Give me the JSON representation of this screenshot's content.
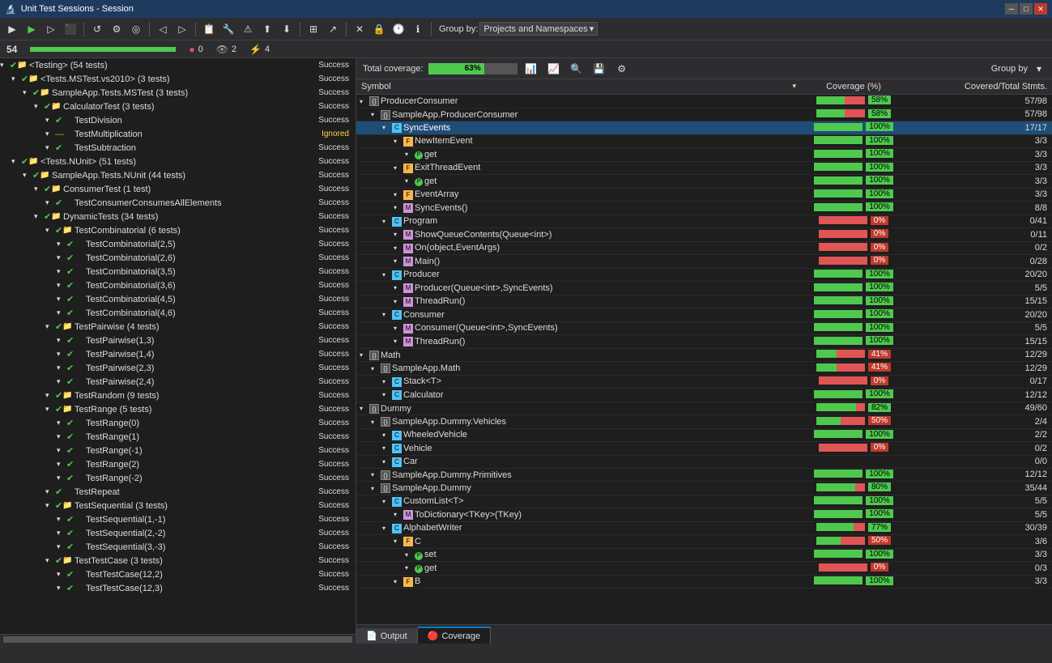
{
  "titleBar": {
    "title": "Unit Test Sessions - Session",
    "winButtons": [
      "minimize",
      "maximize",
      "close"
    ]
  },
  "toolbar": {
    "groupByLabel": "Group by:",
    "groupByValue": "Projects and Namespaces"
  },
  "statsBar": {
    "totalRun": "54",
    "failedCount": "0",
    "passedCount": "2",
    "ignoredCount": "4",
    "progressWidth": "100"
  },
  "leftPanel": {
    "rows": [
      {
        "indent": 0,
        "expand": true,
        "iconType": "check-folder",
        "label": "<Testing> (54 tests)",
        "status": "Success",
        "bold": false
      },
      {
        "indent": 1,
        "expand": true,
        "iconType": "check-folder",
        "label": "<Tests.MSTest.vs2010> (3 tests)",
        "status": "Success",
        "bold": false
      },
      {
        "indent": 2,
        "expand": true,
        "iconType": "check-folder",
        "label": "SampleApp.Tests.MSTest (3 tests)",
        "status": "Success",
        "bold": false
      },
      {
        "indent": 3,
        "expand": true,
        "iconType": "check-folder",
        "label": "CalculatorTest (3 tests)",
        "status": "Success",
        "bold": false
      },
      {
        "indent": 4,
        "expand": false,
        "iconType": "check",
        "label": "TestDivision",
        "status": "Success",
        "bold": false
      },
      {
        "indent": 4,
        "expand": false,
        "iconType": "check",
        "label": "TestMultiplication",
        "status": "Ignored",
        "bold": false
      },
      {
        "indent": 4,
        "expand": false,
        "iconType": "check",
        "label": "TestSubtraction",
        "status": "Success",
        "bold": false
      },
      {
        "indent": 1,
        "expand": true,
        "iconType": "check-folder",
        "label": "<Tests.NUnit> (51 tests)",
        "status": "Success",
        "bold": false
      },
      {
        "indent": 2,
        "expand": true,
        "iconType": "check-folder",
        "label": "SampleApp.Tests.NUnit (44 tests)",
        "status": "Success",
        "bold": false
      },
      {
        "indent": 3,
        "expand": true,
        "iconType": "check-folder",
        "label": "ConsumerTest (1 test)",
        "status": "Success",
        "bold": false
      },
      {
        "indent": 4,
        "expand": false,
        "iconType": "check",
        "label": "TestConsumerConsumesAllElements",
        "status": "Success",
        "bold": false
      },
      {
        "indent": 3,
        "expand": true,
        "iconType": "check-folder",
        "label": "DynamicTests (34 tests)",
        "status": "Success",
        "bold": false
      },
      {
        "indent": 4,
        "expand": true,
        "iconType": "check-folder",
        "label": "TestCombinatorial (6 tests)",
        "status": "Success",
        "bold": false
      },
      {
        "indent": 5,
        "expand": false,
        "iconType": "check",
        "label": "TestCombinatorial(2,5)",
        "status": "Success",
        "bold": false
      },
      {
        "indent": 5,
        "expand": false,
        "iconType": "check",
        "label": "TestCombinatorial(2,6)",
        "status": "Success",
        "bold": false
      },
      {
        "indent": 5,
        "expand": false,
        "iconType": "check",
        "label": "TestCombinatorial(3,5)",
        "status": "Success",
        "bold": false
      },
      {
        "indent": 5,
        "expand": false,
        "iconType": "check",
        "label": "TestCombinatorial(3,6)",
        "status": "Success",
        "bold": false
      },
      {
        "indent": 5,
        "expand": false,
        "iconType": "check",
        "label": "TestCombinatorial(4,5)",
        "status": "Success",
        "bold": false
      },
      {
        "indent": 5,
        "expand": false,
        "iconType": "check",
        "label": "TestCombinatorial(4,6)",
        "status": "Success",
        "bold": false
      },
      {
        "indent": 4,
        "expand": true,
        "iconType": "check-folder",
        "label": "TestPairwise (4 tests)",
        "status": "Success",
        "bold": false
      },
      {
        "indent": 5,
        "expand": false,
        "iconType": "check",
        "label": "TestPairwise(1,3)",
        "status": "Success",
        "bold": false
      },
      {
        "indent": 5,
        "expand": false,
        "iconType": "check",
        "label": "TestPairwise(1,4)",
        "status": "Success",
        "bold": false
      },
      {
        "indent": 5,
        "expand": false,
        "iconType": "check",
        "label": "TestPairwise(2,3)",
        "status": "Success",
        "bold": false
      },
      {
        "indent": 5,
        "expand": false,
        "iconType": "check",
        "label": "TestPairwise(2,4)",
        "status": "Success",
        "bold": false
      },
      {
        "indent": 4,
        "expand": true,
        "iconType": "check-folder",
        "label": "TestRandom (9 tests)",
        "status": "Success",
        "bold": false
      },
      {
        "indent": 4,
        "expand": true,
        "iconType": "check-folder",
        "label": "TestRange (5 tests)",
        "status": "Success",
        "bold": false
      },
      {
        "indent": 5,
        "expand": false,
        "iconType": "check",
        "label": "TestRange(0)",
        "status": "Success",
        "bold": false
      },
      {
        "indent": 5,
        "expand": false,
        "iconType": "check",
        "label": "TestRange(1)",
        "status": "Success",
        "bold": false
      },
      {
        "indent": 5,
        "expand": false,
        "iconType": "check",
        "label": "TestRange(-1)",
        "status": "Success",
        "bold": false
      },
      {
        "indent": 5,
        "expand": false,
        "iconType": "check",
        "label": "TestRange(2)",
        "status": "Success",
        "bold": false
      },
      {
        "indent": 5,
        "expand": false,
        "iconType": "check",
        "label": "TestRange(-2)",
        "status": "Success",
        "bold": false
      },
      {
        "indent": 4,
        "expand": false,
        "iconType": "check",
        "label": "TestRepeat",
        "status": "Success",
        "bold": false
      },
      {
        "indent": 4,
        "expand": true,
        "iconType": "check-folder",
        "label": "TestSequential (3 tests)",
        "status": "Success",
        "bold": false
      },
      {
        "indent": 5,
        "expand": false,
        "iconType": "check",
        "label": "TestSequential(1,-1)",
        "status": "Success",
        "bold": false
      },
      {
        "indent": 5,
        "expand": false,
        "iconType": "check",
        "label": "TestSequential(2,-2)",
        "status": "Success",
        "bold": false
      },
      {
        "indent": 5,
        "expand": false,
        "iconType": "check",
        "label": "TestSequential(3,-3)",
        "status": "Success",
        "bold": false
      },
      {
        "indent": 4,
        "expand": true,
        "iconType": "check-folder",
        "label": "TestTestCase (3 tests)",
        "status": "Success",
        "bold": false
      },
      {
        "indent": 5,
        "expand": false,
        "iconType": "check",
        "label": "TestTestCase(12,2)",
        "status": "Success",
        "bold": false
      },
      {
        "indent": 5,
        "expand": false,
        "iconType": "check",
        "label": "TestTestCase(12,3)",
        "status": "Success",
        "bold": false
      }
    ]
  },
  "coveragePanel": {
    "totalCoverage": "63%",
    "groupByLabel": "Group by",
    "columns": {
      "symbol": "Symbol",
      "coveragePct": "Coverage (%)",
      "coveredTotal": "Covered/Total Stmts."
    },
    "rows": [
      {
        "indent": 0,
        "expand": true,
        "iconType": "namespace",
        "label": "ProducerConsumer",
        "pct": "58%",
        "pctType": "green",
        "covered": "57/98",
        "barGreen": 58
      },
      {
        "indent": 1,
        "expand": true,
        "iconType": "namespace",
        "label": "SampleApp.ProducerConsumer",
        "pct": "58%",
        "pctType": "green",
        "covered": "57/98",
        "barGreen": 58
      },
      {
        "indent": 2,
        "expand": true,
        "iconType": "class",
        "label": "SyncEvents",
        "pct": "100%",
        "pctType": "green",
        "covered": "17/17",
        "barGreen": 100,
        "selected": true
      },
      {
        "indent": 3,
        "expand": true,
        "iconType": "field",
        "label": "NewItemEvent",
        "pct": "100%",
        "pctType": "green",
        "covered": "3/3",
        "barGreen": 100
      },
      {
        "indent": 4,
        "expand": false,
        "iconType": "property",
        "label": "get",
        "pct": "100%",
        "pctType": "green",
        "covered": "3/3",
        "barGreen": 100
      },
      {
        "indent": 3,
        "expand": true,
        "iconType": "field",
        "label": "ExitThreadEvent",
        "pct": "100%",
        "pctType": "green",
        "covered": "3/3",
        "barGreen": 100
      },
      {
        "indent": 4,
        "expand": false,
        "iconType": "property",
        "label": "get",
        "pct": "100%",
        "pctType": "green",
        "covered": "3/3",
        "barGreen": 100
      },
      {
        "indent": 3,
        "expand": false,
        "iconType": "field",
        "label": "EventArray",
        "pct": "100%",
        "pctType": "green",
        "covered": "3/3",
        "barGreen": 100
      },
      {
        "indent": 3,
        "expand": false,
        "iconType": "method",
        "label": "SyncEvents()",
        "pct": "100%",
        "pctType": "green",
        "covered": "8/8",
        "barGreen": 100
      },
      {
        "indent": 2,
        "expand": true,
        "iconType": "class",
        "label": "Program",
        "pct": "0%",
        "pctType": "red",
        "covered": "0/41",
        "barGreen": 0
      },
      {
        "indent": 3,
        "expand": false,
        "iconType": "method",
        "label": "ShowQueueContents(Queue<int>)",
        "pct": "0%",
        "pctType": "red",
        "covered": "0/11",
        "barGreen": 0
      },
      {
        "indent": 3,
        "expand": false,
        "iconType": "method",
        "label": "On(object,EventArgs)",
        "pct": "0%",
        "pctType": "red",
        "covered": "0/2",
        "barGreen": 0
      },
      {
        "indent": 3,
        "expand": false,
        "iconType": "method",
        "label": "Main()",
        "pct": "0%",
        "pctType": "red",
        "covered": "0/28",
        "barGreen": 0
      },
      {
        "indent": 2,
        "expand": true,
        "iconType": "class",
        "label": "Producer",
        "pct": "100%",
        "pctType": "green",
        "covered": "20/20",
        "barGreen": 100
      },
      {
        "indent": 3,
        "expand": false,
        "iconType": "method",
        "label": "Producer(Queue<int>,SyncEvents)",
        "pct": "100%",
        "pctType": "green",
        "covered": "5/5",
        "barGreen": 100
      },
      {
        "indent": 3,
        "expand": false,
        "iconType": "method",
        "label": "ThreadRun()",
        "pct": "100%",
        "pctType": "green",
        "covered": "15/15",
        "barGreen": 100
      },
      {
        "indent": 2,
        "expand": true,
        "iconType": "class",
        "label": "Consumer",
        "pct": "100%",
        "pctType": "green",
        "covered": "20/20",
        "barGreen": 100
      },
      {
        "indent": 3,
        "expand": false,
        "iconType": "method",
        "label": "Consumer(Queue<int>,SyncEvents)",
        "pct": "100%",
        "pctType": "green",
        "covered": "5/5",
        "barGreen": 100
      },
      {
        "indent": 3,
        "expand": false,
        "iconType": "method",
        "label": "ThreadRun()",
        "pct": "100%",
        "pctType": "green",
        "covered": "15/15",
        "barGreen": 100
      },
      {
        "indent": 0,
        "expand": true,
        "iconType": "namespace",
        "label": "Math",
        "pct": "41%",
        "pctType": "red",
        "covered": "12/29",
        "barGreen": 41
      },
      {
        "indent": 1,
        "expand": true,
        "iconType": "namespace",
        "label": "SampleApp.Math",
        "pct": "41%",
        "pctType": "red",
        "covered": "12/29",
        "barGreen": 41
      },
      {
        "indent": 2,
        "expand": true,
        "iconType": "class",
        "label": "Stack<T>",
        "pct": "0%",
        "pctType": "red",
        "covered": "0/17",
        "barGreen": 0
      },
      {
        "indent": 2,
        "expand": false,
        "iconType": "class",
        "label": "Calculator",
        "pct": "100%",
        "pctType": "green",
        "covered": "12/12",
        "barGreen": 100
      },
      {
        "indent": 0,
        "expand": true,
        "iconType": "namespace",
        "label": "Dummy",
        "pct": "82%",
        "pctType": "green",
        "covered": "49/60",
        "barGreen": 82
      },
      {
        "indent": 1,
        "expand": true,
        "iconType": "namespace",
        "label": "SampleApp.Dummy.Vehicles",
        "pct": "50%",
        "pctType": "red",
        "covered": "2/4",
        "barGreen": 50
      },
      {
        "indent": 2,
        "expand": false,
        "iconType": "class",
        "label": "WheeledVehicle",
        "pct": "100%",
        "pctType": "green",
        "covered": "2/2",
        "barGreen": 100
      },
      {
        "indent": 2,
        "expand": false,
        "iconType": "class",
        "label": "Vehicle",
        "pct": "0%",
        "pctType": "red",
        "covered": "0/2",
        "barGreen": 0
      },
      {
        "indent": 2,
        "expand": false,
        "iconType": "class",
        "label": "Car",
        "pct": "",
        "pctType": "gray",
        "covered": "0/0",
        "barGreen": 0
      },
      {
        "indent": 1,
        "expand": true,
        "iconType": "namespace",
        "label": "SampleApp.Dummy.Primitives",
        "pct": "100%",
        "pctType": "green",
        "covered": "12/12",
        "barGreen": 100
      },
      {
        "indent": 1,
        "expand": true,
        "iconType": "namespace",
        "label": "SampleApp.Dummy",
        "pct": "80%",
        "pctType": "green",
        "covered": "35/44",
        "barGreen": 80
      },
      {
        "indent": 2,
        "expand": true,
        "iconType": "class",
        "label": "CustomList<T>",
        "pct": "100%",
        "pctType": "green",
        "covered": "5/5",
        "barGreen": 100
      },
      {
        "indent": 3,
        "expand": false,
        "iconType": "method",
        "label": "ToDictionary<TKey>(TKey)",
        "pct": "100%",
        "pctType": "green",
        "covered": "5/5",
        "barGreen": 100
      },
      {
        "indent": 2,
        "expand": true,
        "iconType": "class",
        "label": "AlphabetWriter",
        "pct": "77%",
        "pctType": "green",
        "covered": "30/39",
        "barGreen": 77
      },
      {
        "indent": 3,
        "expand": true,
        "iconType": "field",
        "label": "C",
        "pct": "50%",
        "pctType": "red",
        "covered": "3/6",
        "barGreen": 50
      },
      {
        "indent": 4,
        "expand": false,
        "iconType": "property",
        "label": "set",
        "pct": "100%",
        "pctType": "green",
        "covered": "3/3",
        "barGreen": 100
      },
      {
        "indent": 4,
        "expand": false,
        "iconType": "property",
        "label": "get",
        "pct": "0%",
        "pctType": "red",
        "covered": "0/3",
        "barGreen": 0
      },
      {
        "indent": 3,
        "expand": false,
        "iconType": "field",
        "label": "B",
        "pct": "100%",
        "pctType": "green",
        "covered": "3/3",
        "barGreen": 100
      }
    ]
  },
  "bottomTabs": {
    "outputLabel": "Output",
    "coverageLabel": "Coverage"
  }
}
